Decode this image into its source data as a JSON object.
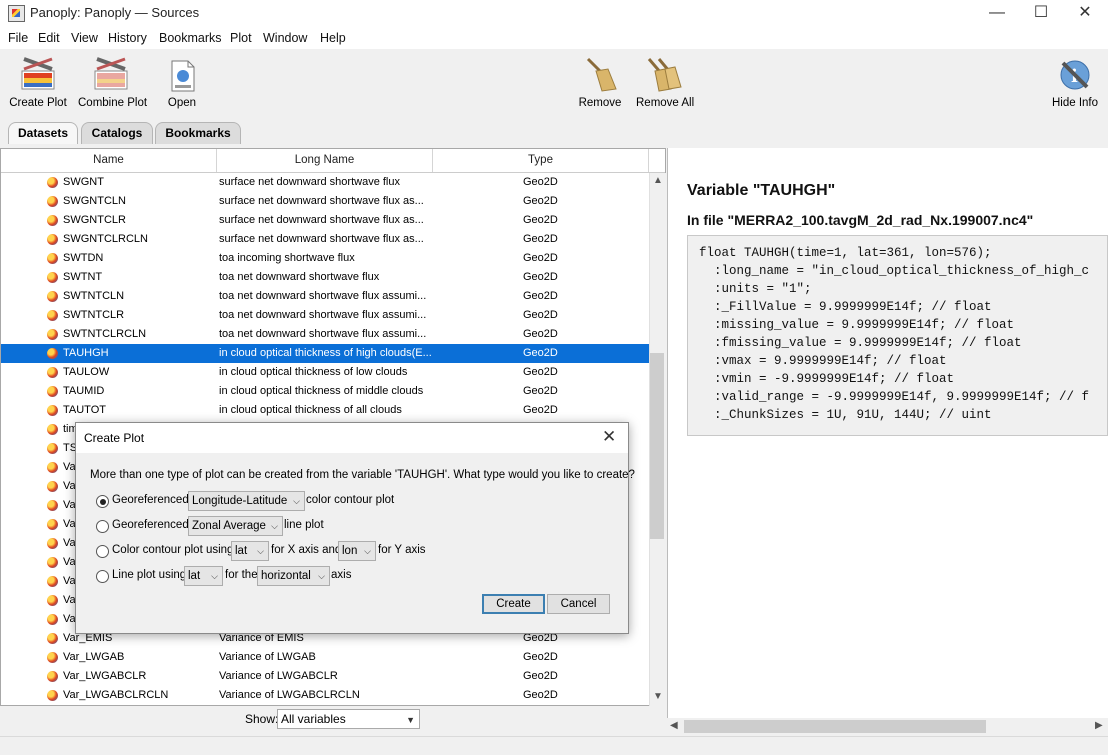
{
  "window": {
    "title": "Panoply: Panoply — Sources",
    "minimize": "—",
    "maximize": "☐",
    "close": "✕"
  },
  "menu": [
    "File",
    "Edit",
    "View",
    "History",
    "Bookmarks",
    "Plot",
    "Window",
    "Help"
  ],
  "toolbar": {
    "create_plot": "Create Plot",
    "combine_plot": "Combine Plot",
    "open": "Open",
    "remove": "Remove",
    "remove_all": "Remove All",
    "hide_info": "Hide Info"
  },
  "tabs": [
    "Datasets",
    "Catalogs",
    "Bookmarks"
  ],
  "table": {
    "columns": [
      "Name",
      "Long Name",
      "Type"
    ],
    "rows": [
      {
        "name": "SWGNT",
        "long": "surface net downward shortwave flux",
        "type": "Geo2D"
      },
      {
        "name": "SWGNTCLN",
        "long": "surface net downward shortwave flux as...",
        "type": "Geo2D"
      },
      {
        "name": "SWGNTCLR",
        "long": "surface net downward shortwave flux as...",
        "type": "Geo2D"
      },
      {
        "name": "SWGNTCLRCLN",
        "long": "surface net downward shortwave flux as...",
        "type": "Geo2D"
      },
      {
        "name": "SWTDN",
        "long": "toa incoming shortwave flux",
        "type": "Geo2D"
      },
      {
        "name": "SWTNT",
        "long": "toa net downward shortwave flux",
        "type": "Geo2D"
      },
      {
        "name": "SWTNTCLN",
        "long": "toa net downward shortwave flux assumi...",
        "type": "Geo2D"
      },
      {
        "name": "SWTNTCLR",
        "long": "toa net downward shortwave flux assumi...",
        "type": "Geo2D"
      },
      {
        "name": "SWTNTCLRCLN",
        "long": "toa net downward shortwave flux assumi...",
        "type": "Geo2D"
      },
      {
        "name": "TAUHGH",
        "long": "in cloud optical thickness of high clouds(E...",
        "type": "Geo2D",
        "selected": true
      },
      {
        "name": "TAULOW",
        "long": "in cloud optical thickness of low clouds",
        "type": "Geo2D"
      },
      {
        "name": "TAUMID",
        "long": "in cloud optical thickness of middle clouds",
        "type": "Geo2D"
      },
      {
        "name": "TAUTOT",
        "long": "in cloud optical thickness of all clouds",
        "type": "Geo2D"
      },
      {
        "name": "tim",
        "long": "",
        "type": ""
      },
      {
        "name": "TS",
        "long": "",
        "type": ""
      },
      {
        "name": "Va",
        "long": "",
        "type": ""
      },
      {
        "name": "Va",
        "long": "",
        "type": ""
      },
      {
        "name": "Va",
        "long": "",
        "type": ""
      },
      {
        "name": "Va",
        "long": "",
        "type": ""
      },
      {
        "name": "Va",
        "long": "",
        "type": ""
      },
      {
        "name": "Va",
        "long": "",
        "type": ""
      },
      {
        "name": "Va",
        "long": "",
        "type": ""
      },
      {
        "name": "Va",
        "long": "",
        "type": ""
      },
      {
        "name": "Va",
        "long": "",
        "type": ""
      },
      {
        "name": "Var_EMIS",
        "long": "Variance of EMIS",
        "type": "Geo2D"
      },
      {
        "name": "Var_LWGAB",
        "long": "Variance of LWGAB",
        "type": "Geo2D"
      },
      {
        "name": "Var_LWGABCLR",
        "long": "Variance of LWGABCLR",
        "type": "Geo2D"
      },
      {
        "name": "Var_LWGABCLRCLN",
        "long": "Variance of LWGABCLRCLN",
        "type": "Geo2D"
      }
    ]
  },
  "show": {
    "label": "Show:",
    "value": "All variables"
  },
  "info": {
    "variable_title": "Variable \"TAUHGH\"",
    "file_title": "In file \"MERRA2_100.tavgM_2d_rad_Nx.199007.nc4\"",
    "code_lines": [
      "float TAUHGH(time=1, lat=361, lon=576);",
      "  :long_name = \"in_cloud_optical_thickness_of_high_c",
      "  :units = \"1\";",
      "  :_FillValue = 9.9999999E14f; // float",
      "  :missing_value = 9.9999999E14f; // float",
      "  :fmissing_value = 9.9999999E14f; // float",
      "  :vmax = 9.9999999E14f; // float",
      "  :vmin = -9.9999999E14f; // float",
      "  :valid_range = -9.9999999E14f, 9.9999999E14f; // f",
      "  :_ChunkSizes = 1U, 91U, 144U; // uint"
    ]
  },
  "dialog": {
    "title": "Create Plot",
    "question": "More than one type of plot can be created from the variable 'TAUHGH'. What type would you like to create?",
    "opt1": {
      "prefix": "Georeferenced",
      "select": "Longitude-Latitude",
      "suffix": "color contour plot"
    },
    "opt2": {
      "prefix": "Georeferenced",
      "select": "Zonal Average",
      "suffix": "line plot"
    },
    "opt3": {
      "prefix": "Color contour plot using",
      "select_x": "lat",
      "mid": "for X axis and",
      "select_y": "lon",
      "suffix": "for Y axis"
    },
    "opt4": {
      "prefix": "Line plot using",
      "select": "lat",
      "mid": "for the",
      "select2": "horizontal",
      "suffix": "axis"
    },
    "create": "Create",
    "cancel": "Cancel"
  },
  "colors": {
    "selection": "#0b6fd7",
    "dialog_default_border": "#3c7fb1"
  }
}
